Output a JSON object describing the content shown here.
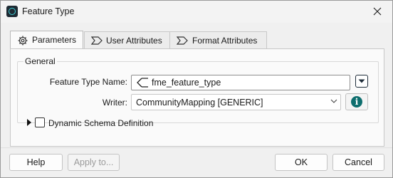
{
  "window": {
    "title": "Feature Type"
  },
  "tabs": [
    {
      "label": "Parameters",
      "icon": "gear-icon",
      "active": true
    },
    {
      "label": "User Attributes",
      "icon": "attributes-icon",
      "active": false
    },
    {
      "label": "Format Attributes",
      "icon": "attributes-icon",
      "active": false
    }
  ],
  "general": {
    "title": "General",
    "feature_type_name_label": "Feature Type Name:",
    "feature_type_name_value": "fme_feature_type",
    "writer_label": "Writer:",
    "writer_value": "CommunityMapping [GENERIC]",
    "dynamic_schema_label": "Dynamic Schema Definition"
  },
  "buttons": {
    "help": "Help",
    "apply_to": "Apply to...",
    "ok": "OK",
    "cancel": "Cancel"
  },
  "colors": {
    "accent": "#0e6e6e",
    "icon_cyan": "#3fd1d8"
  }
}
